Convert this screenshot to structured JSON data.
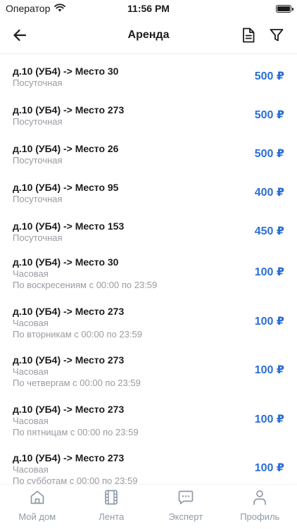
{
  "status_bar": {
    "carrier": "Оператор",
    "time": "11:56 PM"
  },
  "nav": {
    "title": "Аренда"
  },
  "colors": {
    "accent": "#2b6fd6",
    "secondary_text": "#9a9aa3",
    "tab_inactive": "#8e9aa8"
  },
  "icons": {
    "back": "arrow-left-icon",
    "document": "document-icon",
    "filter": "filter-icon"
  },
  "rentals": [
    {
      "title": "д.10 (УБ4) -> Место 30",
      "type": "Посуточная",
      "schedule": "",
      "price": "500 ₽"
    },
    {
      "title": "д.10 (УБ4) -> Место 273",
      "type": "Посуточная",
      "schedule": "",
      "price": "500 ₽"
    },
    {
      "title": "д.10 (УБ4) -> Место 26",
      "type": "Посуточная",
      "schedule": "",
      "price": "500 ₽"
    },
    {
      "title": "д.10 (УБ4) -> Место 95",
      "type": "Посуточная",
      "schedule": "",
      "price": "400 ₽"
    },
    {
      "title": "д.10 (УБ4) -> Место 153",
      "type": "Посуточная",
      "schedule": "",
      "price": "450 ₽"
    },
    {
      "title": "д.10 (УБ4) -> Место 30",
      "type": "Часовая",
      "schedule": "По воскресениям с 00:00 по 23:59",
      "price": "100 ₽"
    },
    {
      "title": "д.10 (УБ4) -> Место 273",
      "type": "Часовая",
      "schedule": "По вторникам с 00:00 по 23:59",
      "price": "100 ₽"
    },
    {
      "title": "д.10 (УБ4) -> Место 273",
      "type": "Часовая",
      "schedule": "По четвергам с 00:00 по 23:59",
      "price": "100 ₽"
    },
    {
      "title": "д.10 (УБ4) -> Место 273",
      "type": "Часовая",
      "schedule": "По пятницам с 00:00 по 23:59",
      "price": "100 ₽"
    },
    {
      "title": "д.10 (УБ4) -> Место 273",
      "type": "Часовая",
      "schedule": "По субботам с 00:00 по 23:59",
      "price": "100 ₽"
    }
  ],
  "tabs": [
    {
      "label": "Мой дом",
      "icon": "home-icon"
    },
    {
      "label": "Лента",
      "icon": "film-icon"
    },
    {
      "label": "Эксперт",
      "icon": "chat-icon"
    },
    {
      "label": "Профиль",
      "icon": "person-icon"
    }
  ]
}
